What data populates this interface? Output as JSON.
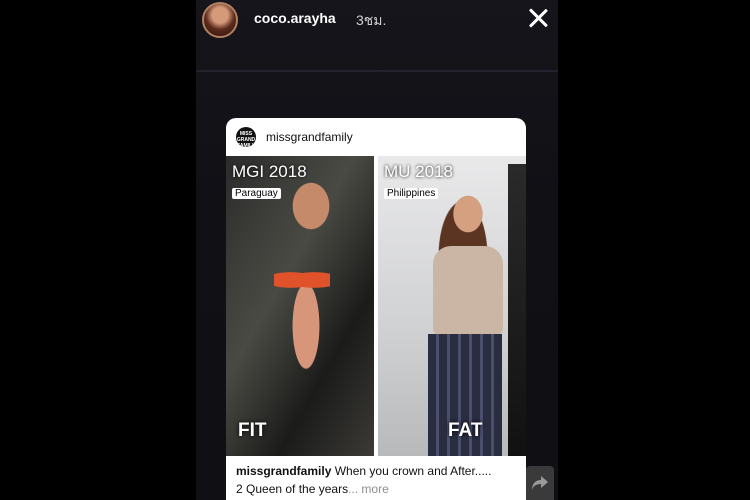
{
  "story": {
    "username": "coco.arayha",
    "time_ago": "3ชม."
  },
  "card": {
    "account": "missgrandfamily",
    "logo_text": "MISS GRAND FAMILY",
    "left_photo": {
      "title": "MGI 2018",
      "country": "Paraguay",
      "tag": "FIT"
    },
    "right_photo": {
      "title": "MU 2018",
      "country": "Philippines",
      "tag": "FAT"
    },
    "caption": {
      "account": "missgrandfamily",
      "line1": "When you crown and After.....",
      "line2": "2 Queen of the years",
      "more": "... more"
    }
  },
  "icons": {
    "close": "close-icon",
    "share": "share-arrow-icon"
  }
}
